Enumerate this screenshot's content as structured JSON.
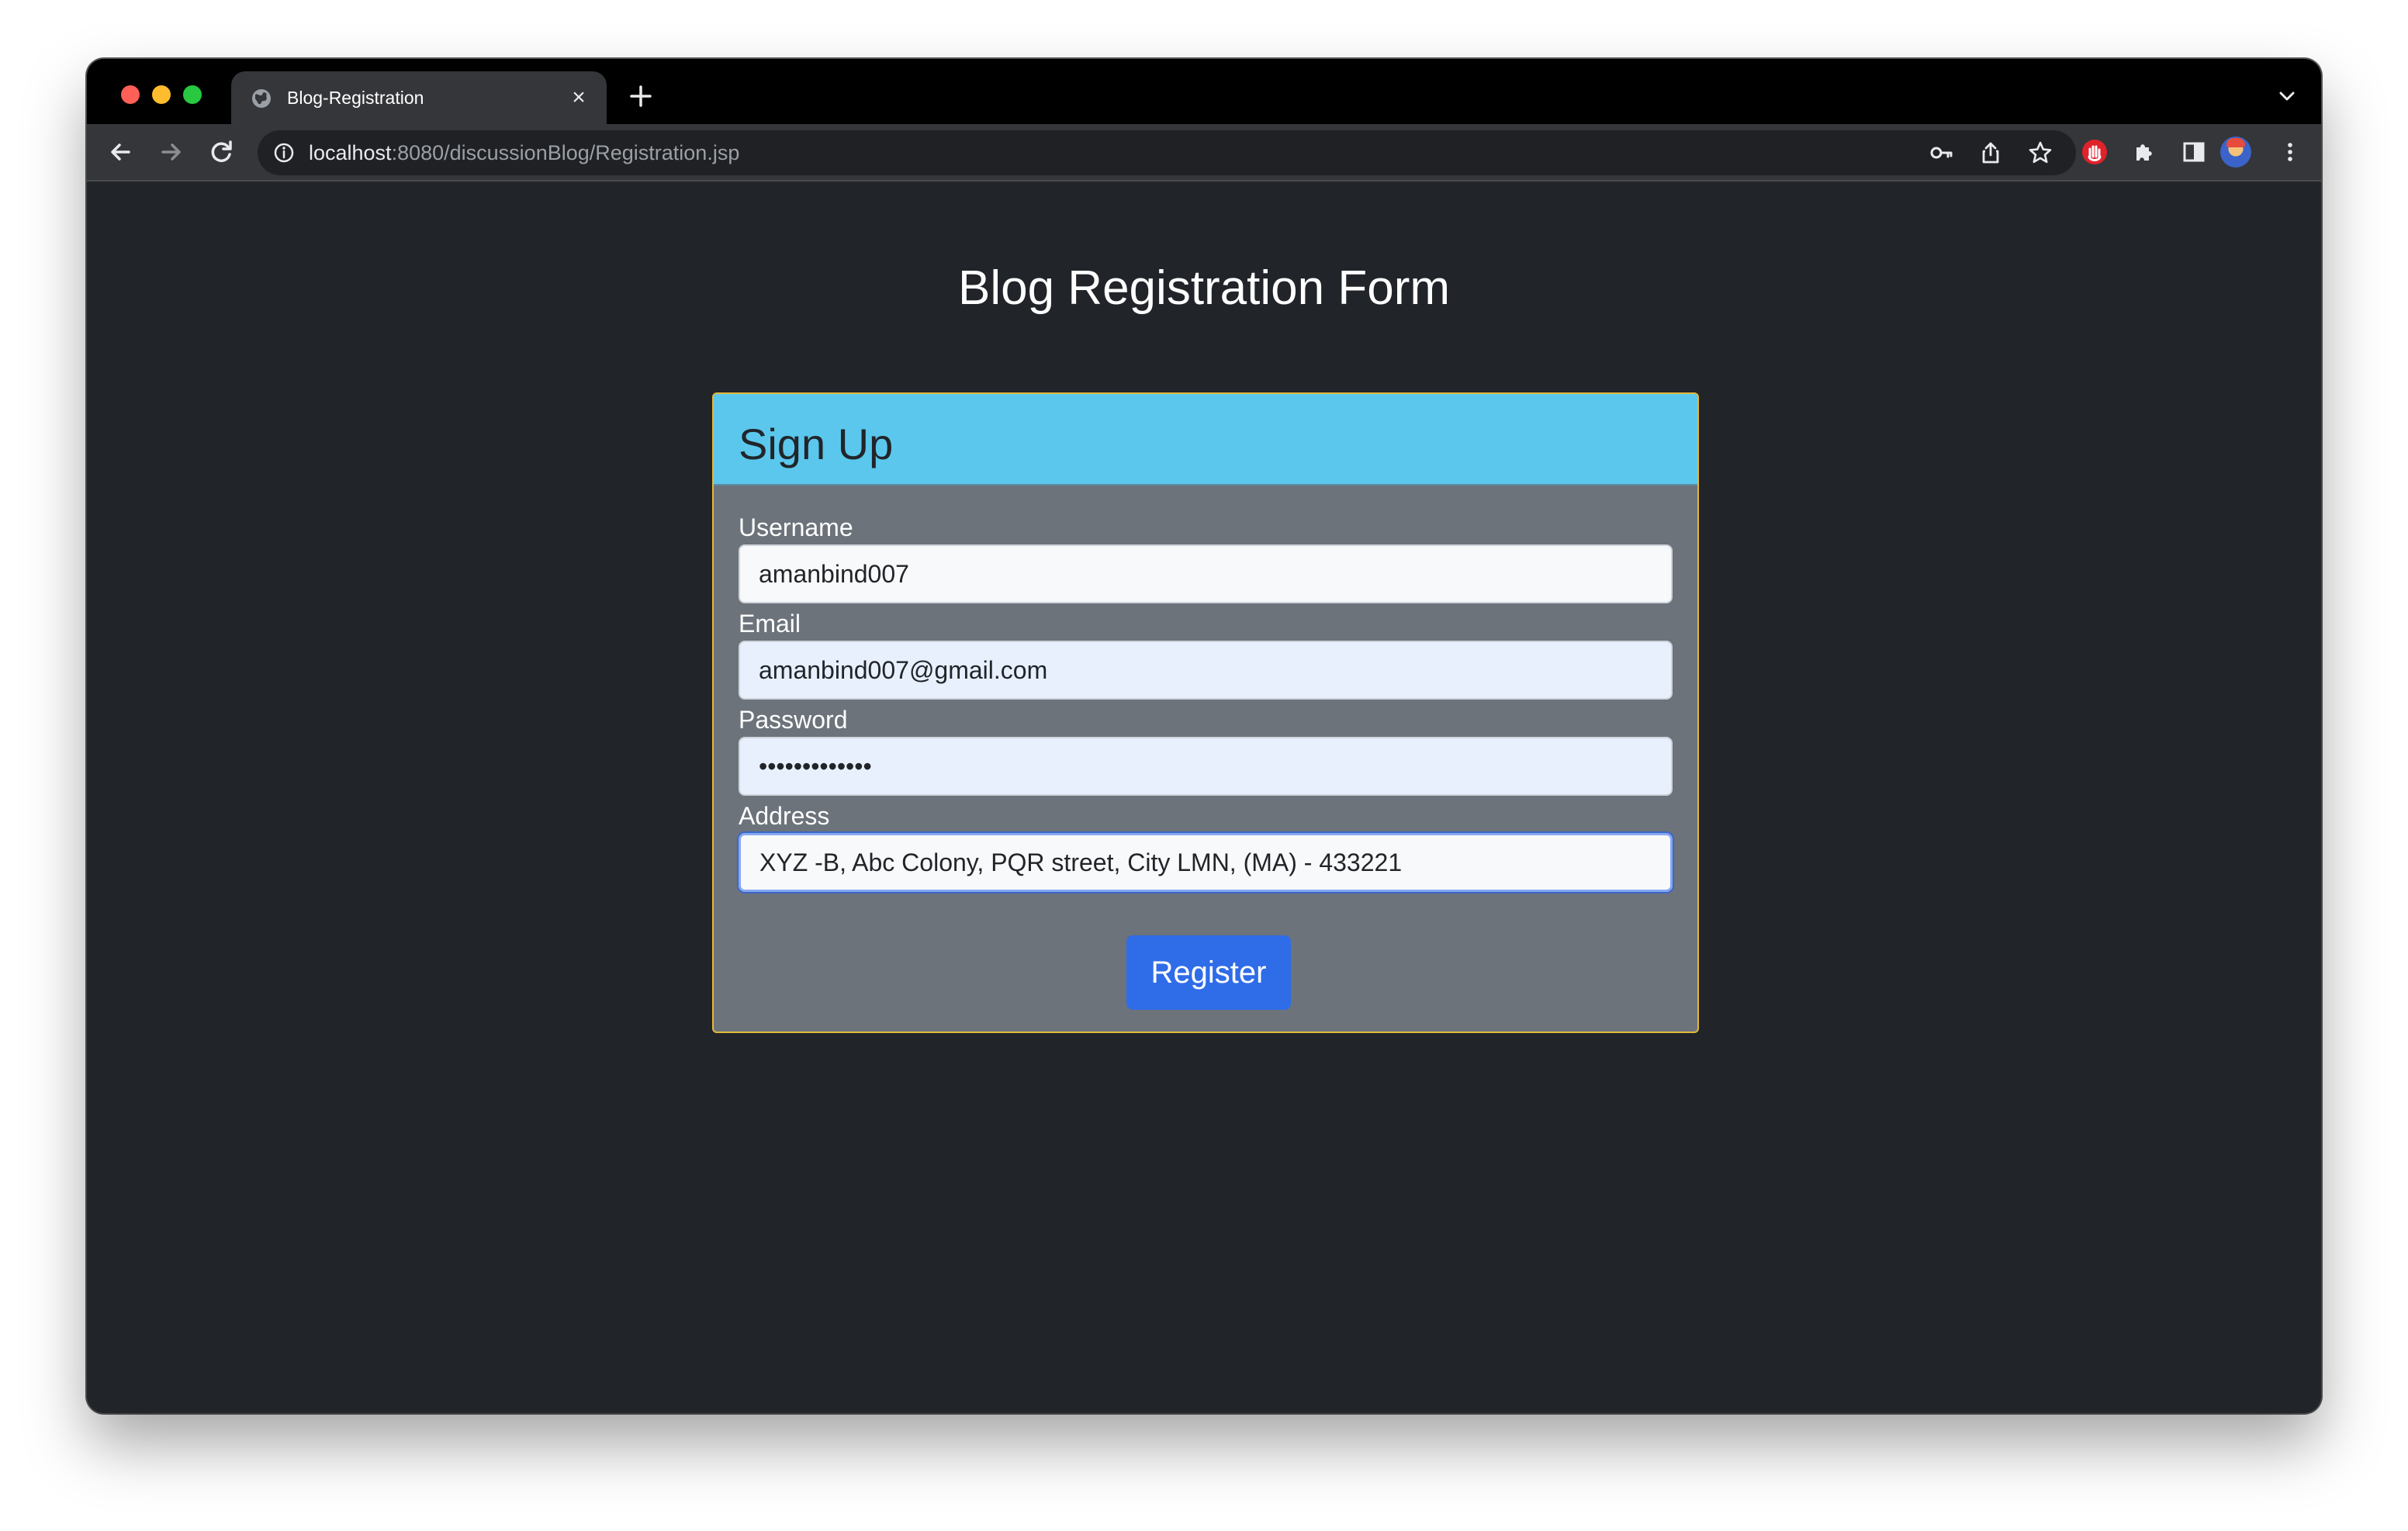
{
  "browser": {
    "tab_title": "Blog-Registration",
    "url_host": "localhost",
    "url_rest": ":8080/discussionBlog/Registration.jsp"
  },
  "page": {
    "title": "Blog Registration Form"
  },
  "card": {
    "header": "Sign Up",
    "fields": [
      {
        "label": "Username",
        "value": "amanbind007"
      },
      {
        "label": "Email",
        "value": "amanbind007@gmail.com"
      },
      {
        "label": "Password",
        "value": "•••••••••••••"
      },
      {
        "label": "Address",
        "value": "XYZ -B, Abc Colony, PQR street, City LMN, (MA) - 433221"
      }
    ],
    "submit_label": "Register"
  },
  "colors": {
    "page_bg": "#212429",
    "card_header": "#5bc7ec",
    "card_body": "#6c737b",
    "card_border": "#e2b93b",
    "button": "#2f6ce8"
  }
}
